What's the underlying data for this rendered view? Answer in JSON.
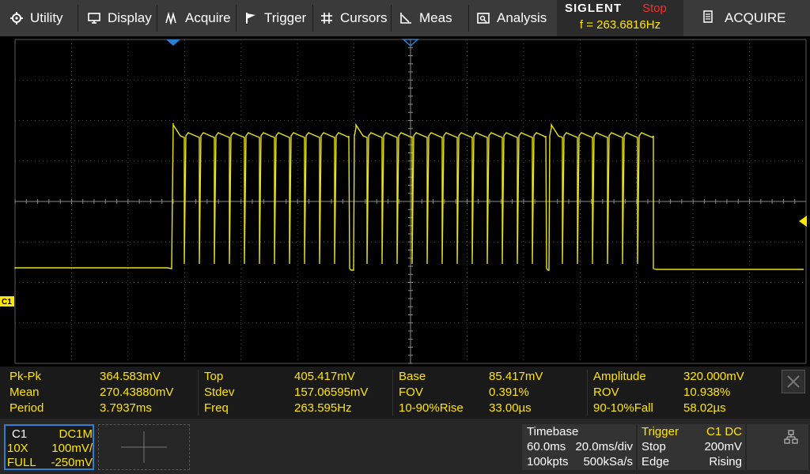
{
  "menu": [
    {
      "label": "Utility",
      "icon": "gear-icon"
    },
    {
      "label": "Display",
      "icon": "monitor-icon"
    },
    {
      "label": "Acquire",
      "icon": "acquire-icon"
    },
    {
      "label": "Trigger",
      "icon": "flag-icon"
    },
    {
      "label": "Cursors",
      "icon": "cursors-icon"
    },
    {
      "label": "Meas",
      "icon": "measure-icon"
    },
    {
      "label": "Analysis",
      "icon": "analysis-icon"
    }
  ],
  "brand": {
    "name": "SIGLENT",
    "run_state": "Stop",
    "frequency": "f = 263.6816Hz"
  },
  "acquire_button": {
    "label": "ACQUIRE",
    "icon": "document-icon"
  },
  "channel_marker": "C1",
  "colors": {
    "trace": "#e8e21b",
    "grid": "#5a5a5a",
    "accent": "#2f7fd1",
    "label": "#ffe600"
  },
  "measurements": [
    [
      {
        "label": "Pk-Pk",
        "value": "364.583mV"
      },
      {
        "label": "Top",
        "value": "405.417mV"
      },
      {
        "label": "Base",
        "value": "85.417mV"
      },
      {
        "label": "Amplitude",
        "value": "320.000mV"
      }
    ],
    [
      {
        "label": "Mean",
        "value": "270.43880mV"
      },
      {
        "label": "Stdev",
        "value": "157.06595mV"
      },
      {
        "label": "FOV",
        "value": "0.391%"
      },
      {
        "label": "ROV",
        "value": "10.938%"
      }
    ],
    [
      {
        "label": "Period",
        "value": "3.7937ms"
      },
      {
        "label": "Freq",
        "value": "263.595Hz"
      },
      {
        "label": "10-90%Rise",
        "value": "33.00µs"
      },
      {
        "label": "90-10%Fall",
        "value": "58.02µs"
      }
    ]
  ],
  "channel1": {
    "name": "C1",
    "coupling": "DC1M",
    "probe": "10X",
    "scale": "100mV/",
    "bandwidth": "FULL",
    "offset": "-250mV"
  },
  "timebase": {
    "title": "Timebase",
    "delay": "60.0ms",
    "scale": "20.0ms/div",
    "memory": "100kpts",
    "sample_rate": "500kSa/s"
  },
  "trigger": {
    "title": "Trigger",
    "source": "C1 DC",
    "level": "200mV",
    "type": "Edge",
    "slope": "Rising",
    "status": "Stop"
  }
}
